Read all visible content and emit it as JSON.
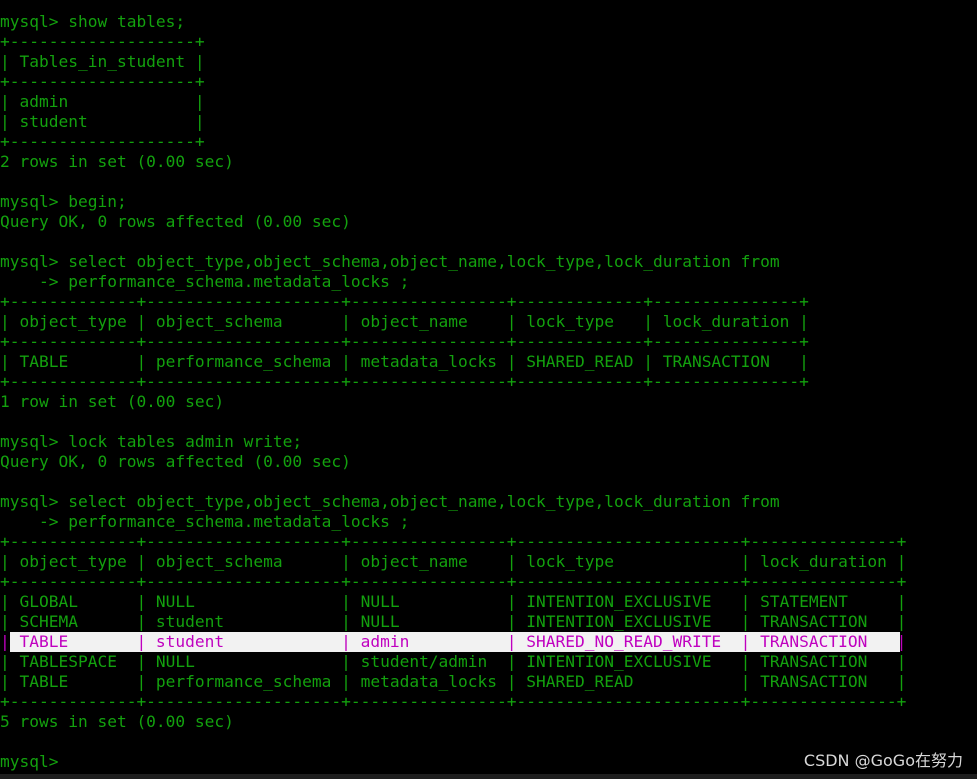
{
  "terminal": {
    "lines": [
      "mysql> show tables;",
      "+-------------------+",
      "| Tables_in_student |",
      "+-------------------+",
      "| admin             |",
      "| student           |",
      "+-------------------+",
      "2 rows in set (0.00 sec)",
      "",
      "mysql> begin;",
      "Query OK, 0 rows affected (0.00 sec)",
      "",
      "mysql> select object_type,object_schema,object_name,lock_type,lock_duration from",
      "    -> performance_schema.metadata_locks ;",
      "+-------------+--------------------+----------------+-------------+---------------+",
      "| object_type | object_schema      | object_name    | lock_type   | lock_duration |",
      "+-------------+--------------------+----------------+-------------+---------------+",
      "| TABLE       | performance_schema | metadata_locks | SHARED_READ | TRANSACTION   |",
      "+-------------+--------------------+----------------+-------------+---------------+",
      "1 row in set (0.00 sec)",
      "",
      "mysql> lock tables admin write;",
      "Query OK, 0 rows affected (0.00 sec)",
      "",
      "mysql> select object_type,object_schema,object_name,lock_type,lock_duration from",
      "    -> performance_schema.metadata_locks ;",
      "+-------------+--------------------+----------------+-----------------------+---------------+",
      "| object_type | object_schema      | object_name    | lock_type             | lock_duration |",
      "+-------------+--------------------+----------------+-----------------------+---------------+",
      "| GLOBAL      | NULL               | NULL           | INTENTION_EXCLUSIVE   | STATEMENT     |",
      "| SCHEMA      | student            | NULL           | INTENTION_EXCLUSIVE   | TRANSACTION   |",
      "| TABLE       | student            | admin          | SHARED_NO_READ_WRITE  | TRANSACTION   |",
      "| TABLESPACE  | NULL               | student/admin  | INTENTION_EXCLUSIVE   | TRANSACTION   |",
      "| TABLE       | performance_schema | metadata_locks | SHARED_READ           | TRANSACTION   |",
      "+-------------+--------------------+----------------+-----------------------+---------------+",
      "5 rows in set (0.00 sec)",
      "",
      "mysql>"
    ],
    "highlighted_line": 31,
    "colors": {
      "background": "#000000",
      "text": "#13a10e",
      "highlight_bg": "#f2f2f2",
      "highlight_text": "#c000c0"
    }
  },
  "watermark": "CSDN @GoGo在努力"
}
